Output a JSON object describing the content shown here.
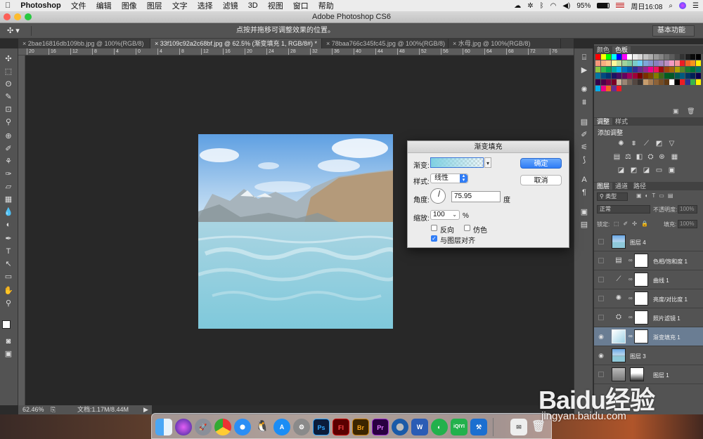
{
  "menubar": {
    "apple": "",
    "app_name": "Photoshop",
    "items": [
      "文件",
      "编辑",
      "图像",
      "图层",
      "文字",
      "选择",
      "滤镜",
      "3D",
      "视图",
      "窗口",
      "帮助"
    ],
    "battery": "95%",
    "clock": "周日16:08"
  },
  "window": {
    "title": "Adobe Photoshop CS6"
  },
  "options_bar": {
    "hint": "点按并拖移可调整效果的位置。",
    "workspace": "基本功能"
  },
  "tabs": [
    {
      "label": "2bae16816db109bb.jpg @ 100%(RGB/8)"
    },
    {
      "label": "33f109c92a2c68bf.jpg @ 62.5% (渐变填充 1, RGB/8#) *"
    },
    {
      "label": "78baa766c345fc45.jpg @ 100%(RGB/8)"
    },
    {
      "label": "水母.jpg @ 100%(RGB/8)"
    }
  ],
  "ruler_ticks": [
    "20",
    "16",
    "12",
    "8",
    "4",
    "0",
    "4",
    "8",
    "12",
    "16",
    "20",
    "24",
    "28",
    "32",
    "36",
    "40",
    "44",
    "48",
    "52",
    "56",
    "60",
    "64",
    "68",
    "72",
    "76"
  ],
  "status": {
    "zoom": "62.46%",
    "doc": "文档:1.17M/8.44M"
  },
  "panels": {
    "color_tabs": [
      "颜色",
      "色板"
    ],
    "adjust_tabs": [
      "调整",
      "样式"
    ],
    "adjust_title": "添加调整",
    "layers_tabs": [
      "图层",
      "通道",
      "路径"
    ],
    "filter_kind": "类型",
    "blend_mode": "正常",
    "opacity_label": "不透明度:",
    "opacity_value": "100%",
    "lock_label": "锁定:",
    "fill_label": "填充:",
    "fill_value": "100%",
    "layers": [
      {
        "name": "图层 4",
        "visible": false
      },
      {
        "name": "色相/饱和度 1",
        "visible": false
      },
      {
        "name": "曲线 1",
        "visible": false
      },
      {
        "name": "亮度/对比度 1",
        "visible": false
      },
      {
        "name": "照片滤镜 1",
        "visible": false
      },
      {
        "name": "渐变填充 1",
        "visible": true
      },
      {
        "name": "图层 3",
        "visible": true
      },
      {
        "name": "图层 1",
        "visible": false
      }
    ]
  },
  "dialog": {
    "title": "渐变填充",
    "gradient_label": "渐变:",
    "style_label": "样式:",
    "style_value": "线性",
    "angle_label": "角度:",
    "angle_value": "75.95",
    "angle_unit": "度",
    "scale_label": "缩放:",
    "scale_value": "100",
    "scale_unit": "%",
    "reverse_label": "反向",
    "dither_label": "仿色",
    "align_label": "与图层对齐",
    "reverse_checked": false,
    "dither_checked": false,
    "align_checked": true,
    "ok_label": "确定",
    "cancel_label": "取消"
  },
  "dock": [
    "Ps",
    "Fl",
    "Br",
    "Pr"
  ],
  "watermark": {
    "brand": "Baidu经验",
    "url": "jingyan.baidu.com"
  },
  "colors": {
    "accent": "#2f7cf6",
    "panel": "#535353",
    "canvas": "#282828"
  }
}
